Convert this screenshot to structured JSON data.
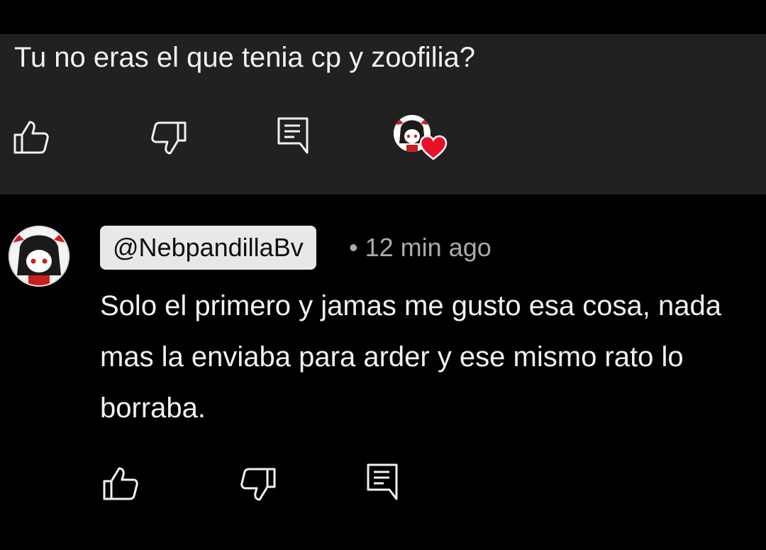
{
  "parent_comment": {
    "text": "Tu no eras el que tenia cp y zoofilia?",
    "actions": {
      "like_icon": "thumbs-up-outline",
      "dislike_icon": "thumbs-down-outline",
      "reply_icon": "comment-outline",
      "creator_heart_icon": "creator-heart"
    }
  },
  "reply_comment": {
    "handle": "@NebpandillaBv",
    "separator": "•",
    "time": "12 min ago",
    "text": "Solo el primero y jamas me gusto esa cosa, nada mas la enviaba para arder y ese mismo rato lo borraba.",
    "actions": {
      "like_icon": "thumbs-up-outline",
      "dislike_icon": "thumbs-down-outline",
      "reply_icon": "comment-outline"
    }
  },
  "colors": {
    "background": "#000000",
    "parent_background": "#212121",
    "text": "#f1f1f1",
    "secondary_text": "#aaaaaa",
    "chip_background": "#e8e8e8",
    "heart": "#e8112d"
  }
}
